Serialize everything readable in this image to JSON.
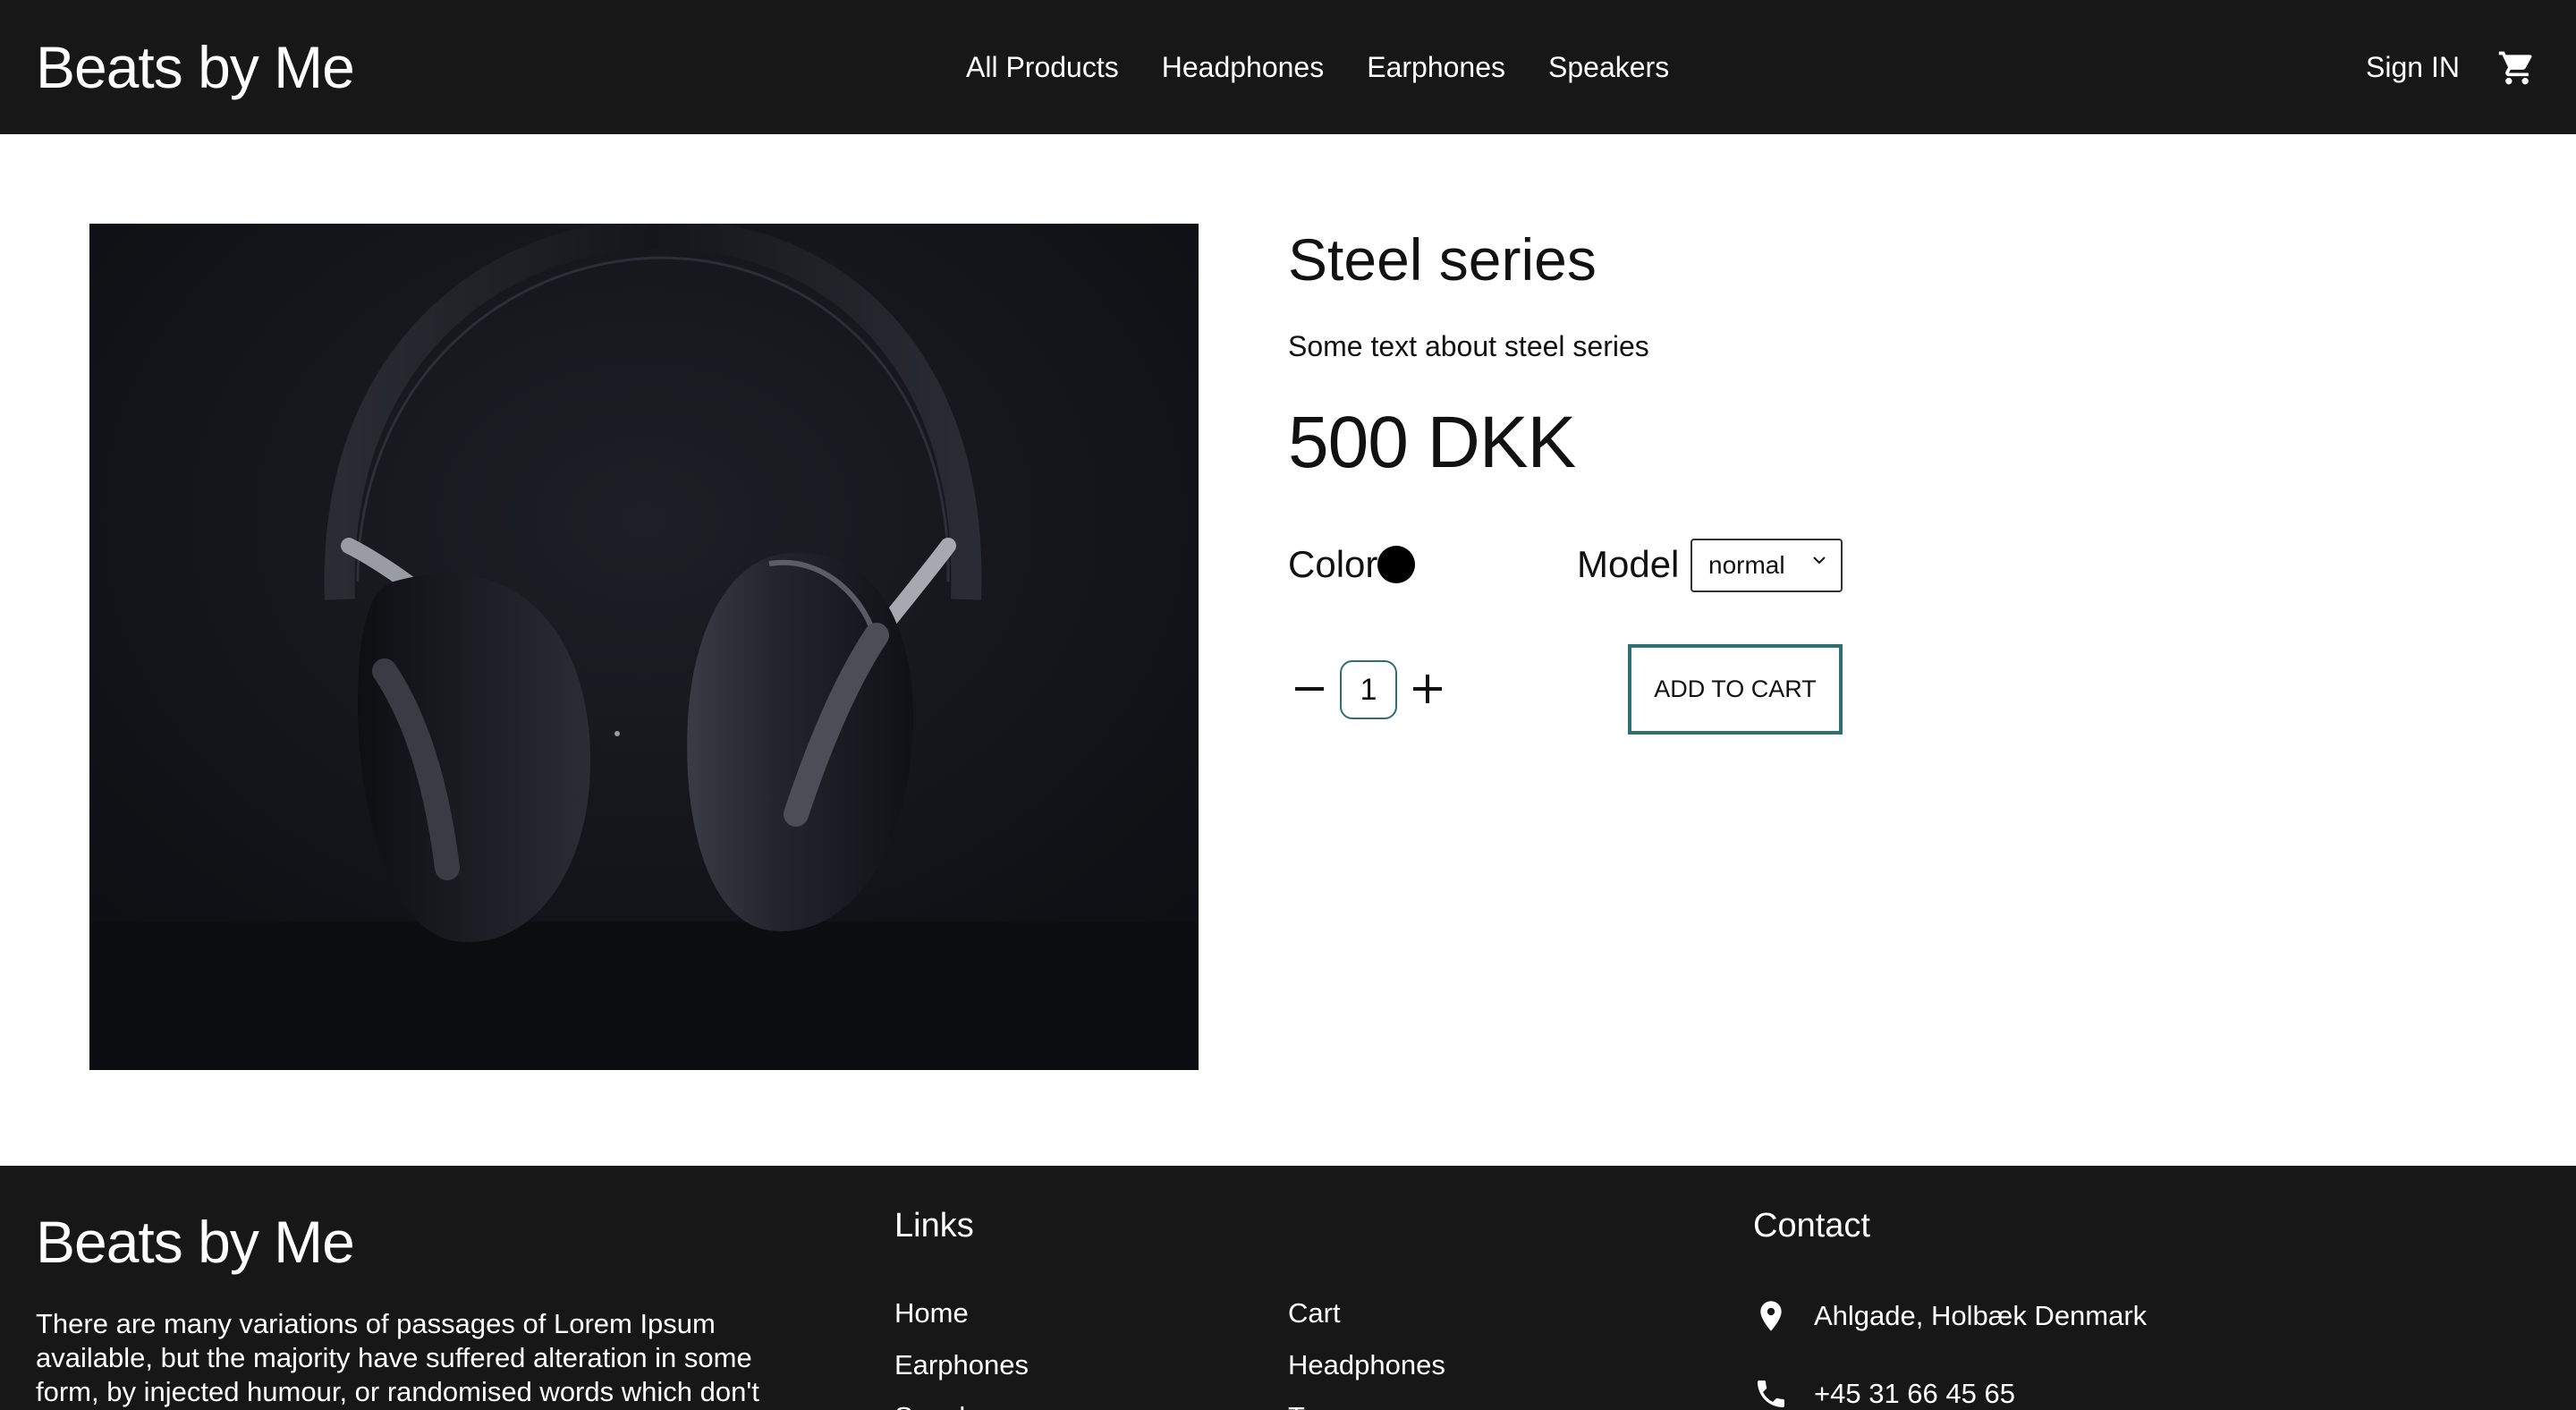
{
  "header": {
    "logo": "Beats by Me",
    "nav": [
      "All Products",
      "Headphones",
      "Earphones",
      "Speakers"
    ],
    "sign_in": "Sign IN",
    "cart_icon": "cart-icon"
  },
  "product": {
    "image_icon": "headphones-photo",
    "title": "Steel series",
    "description": "Some text about steel series",
    "price": "500 DKK",
    "color_label": "Color",
    "color_value": "#000000",
    "model_label": "Model",
    "model_selected": "normal",
    "quantity": "1",
    "add_to_cart": "ADD TO CART",
    "accent": "#2f6e73"
  },
  "footer": {
    "logo": "Beats by Me",
    "about": "There are many variations of passages of Lorem Ipsum available, but the majority have suffered alteration in some form, by injected humour, or randomised words which don't",
    "links_title": "Links",
    "links_col1": [
      "Home",
      "Earphones",
      "Speakers"
    ],
    "links_col2": [
      "Cart",
      "Headphones",
      "Terms"
    ],
    "contact_title": "Contact",
    "address": "Ahlgade, Holbæk Denmark",
    "phone": "+45 31 66 45 65"
  }
}
